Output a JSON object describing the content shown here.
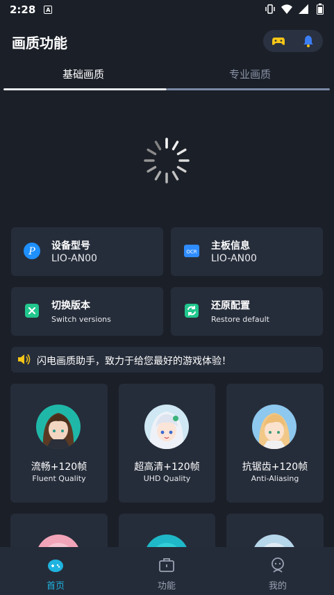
{
  "status": {
    "time": "2:28",
    "notif_icon": "A"
  },
  "header": {
    "title": "画质功能",
    "actions": [
      "gamepad-icon",
      "bell-icon"
    ]
  },
  "tabs": [
    {
      "label": "基础画质",
      "active": true
    },
    {
      "label": "专业画质",
      "active": false
    }
  ],
  "info_cards": [
    {
      "title": "设备型号",
      "value": "LIO-AN00",
      "icon": "p-logo-icon"
    },
    {
      "title": "主板信息",
      "value": "LIO-AN00",
      "icon": "ocr-chip-icon"
    },
    {
      "title": "切换版本",
      "value": "Switch versions",
      "icon": "switch-icon"
    },
    {
      "title": "还原配置",
      "value": "Restore default",
      "icon": "restore-icon"
    }
  ],
  "notice": {
    "text": "闪电画质助手，致力于给您最好的游戏体验！"
  },
  "modes": [
    {
      "title": "流畅+120帧",
      "subtitle": "Fluent Quality"
    },
    {
      "title": "超高清+120帧",
      "subtitle": "UHD Quality"
    },
    {
      "title": "抗锯齿+120帧",
      "subtitle": "Anti-Aliasing"
    }
  ],
  "bottom_nav": [
    {
      "label": "首页",
      "active": true
    },
    {
      "label": "功能",
      "active": false
    },
    {
      "label": "我的",
      "active": false
    }
  ],
  "colors": {
    "background": "#1b1f28",
    "card": "#262d3a",
    "accent": "#1fb3e0"
  }
}
